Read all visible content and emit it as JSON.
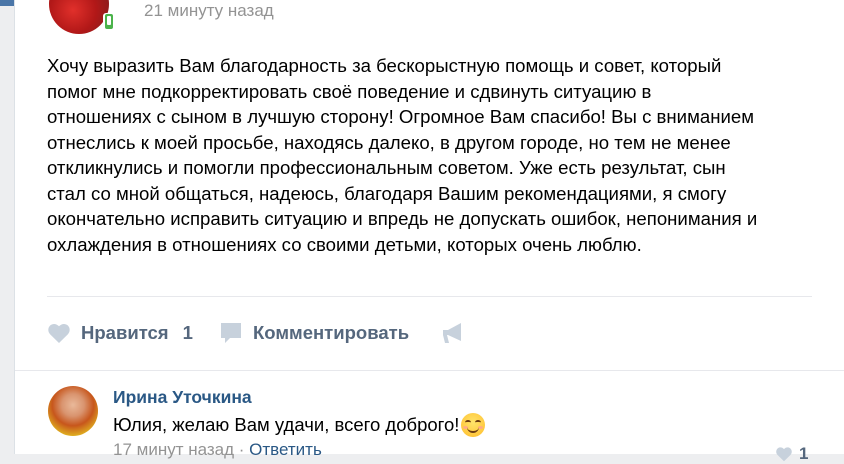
{
  "post": {
    "time": "21 минуту назад",
    "text": "Хочу выразить Вам благодарность за бескорыстную помощь и совет, который\nпомог мне подкорректировать своё поведение и сдвинуть ситуацию в\nотношениях с сыном в лучшую сторону! Огромное Вам спасибо! Вы с вниманием\nотнеслись к моей просьбе, находясь далеко, в другом городе, но тем не менее\nоткликнулись и помогли профессиональным советом. Уже есть результат, сын\nстал со мной общаться, надеюсь, благодаря Вашим рекомендациями, я смогу\nокончательно исправить ситуацию и впредь не допускать ошибок, непонимания и\nохлаждения в отношениях со своими детьми, которых очень люблю."
  },
  "actions": {
    "like_label": "Нравится",
    "like_count": "1",
    "comment_label": "Комментировать"
  },
  "comment": {
    "author": "Ирина Уточкина",
    "text": "Юлия, желаю Вам удачи, всего доброго!",
    "emoji": "blush-smile-icon",
    "time": "17 минут назад",
    "separator": " · ",
    "reply_label": "Ответить",
    "like_count": "1"
  },
  "colors": {
    "accent": "#4a76a8",
    "link": "#2a5885",
    "action": "#55677d",
    "muted": "#939393",
    "online": "#4bb34b"
  }
}
